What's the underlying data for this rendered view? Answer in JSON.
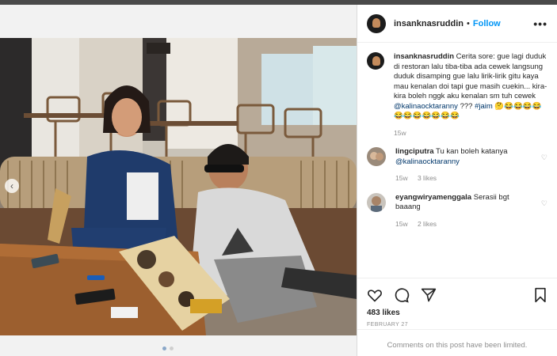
{
  "post": {
    "username": "insanknasruddin",
    "follow_label": "Follow",
    "separator": "•",
    "more_label": "•••"
  },
  "caption": {
    "username": "insanknasruddin",
    "text": "Cerita sore: gue lagi duduk di restoran lalu tiba-tiba ada cewek langsung duduk disamping gue lalu lirik-lirik gitu kaya mau kenalan doi tapi gue masih cuekin... kira-kira boleh nggk aku kenalan sm tuh cewek",
    "mention": "@kalinaocktaranny",
    "question": "???",
    "hashtag": "#jaim",
    "emojis": "🤔😂😂😂😂😂😂😂😂😂😂😂",
    "time": "15w"
  },
  "comments": [
    {
      "username": "lingciputra",
      "text": "Tu kan boleh katanya",
      "mention": "@kalinaocktaranny",
      "time": "15w",
      "likes": "3 likes"
    },
    {
      "username": "eyangwiryamenggala",
      "text": "Serasii bgt baaang",
      "time": "15w",
      "likes": "2 likes"
    }
  ],
  "footer": {
    "likes": "483 likes",
    "date": "FEBRUARY 27",
    "limited": "Comments on this post have been limited."
  },
  "icons": {
    "like": "heart-icon",
    "comment": "comment-icon",
    "share": "share-icon",
    "save": "bookmark-icon"
  },
  "colors": {
    "follow": "#0095f6",
    "mention": "#00376b",
    "muted": "#8e8e8e"
  }
}
